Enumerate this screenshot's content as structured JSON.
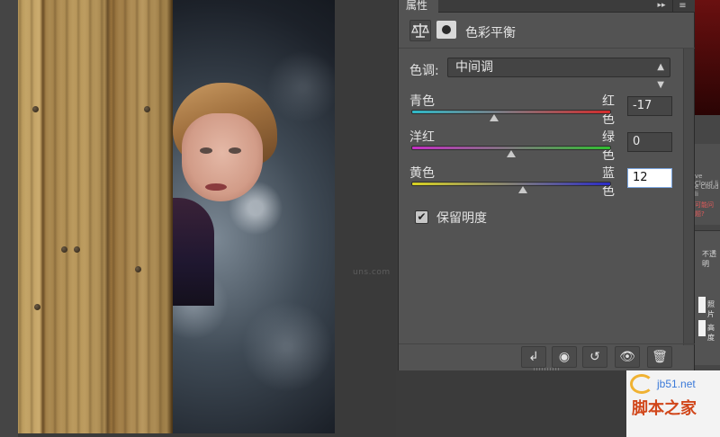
{
  "panel": {
    "tab_label": "属性",
    "collapse_glyph": "▸▸",
    "menu_glyph": "≡",
    "title": "色彩平衡",
    "tone_label": "色调:",
    "tone_value": "中间调",
    "sliders": [
      {
        "left": "青色",
        "right": "红色",
        "value": "-17",
        "position": 0.415
      },
      {
        "left": "洋红",
        "right": "绿色",
        "value": "0",
        "position": 0.5
      },
      {
        "left": "黄色",
        "right": "蓝色",
        "value": "12",
        "position": 0.56
      }
    ],
    "preserve_label": "保留明度",
    "preserve_checked": true,
    "footer_icons": [
      "clip-to-layer-icon",
      "view-previous-icon",
      "reset-icon",
      "visibility-icon",
      "delete-icon"
    ],
    "footer_glyphs": [
      "↲",
      "◉",
      "↺",
      "👁",
      "🗑"
    ]
  },
  "canvas": {
    "watermark": "uns.com"
  },
  "right_dock": {
    "cc_line1": "ve Cloud li",
    "cc_line2": "e Cloud li",
    "cc_line3": "可能问题?",
    "opacity_label": "不透明",
    "layer1_name": "照片",
    "layer2_name": "高度"
  },
  "site_logo": {
    "url": "jb51.net",
    "name": "脚本之家"
  },
  "colors": {
    "panel_bg": "#535353",
    "accent_input": "#7aa5e0",
    "track_cyan_red": [
      "#2fb9c8",
      "#d42b2b"
    ],
    "track_magenta_green": [
      "#c42ec4",
      "#30c030"
    ],
    "track_yellow_blue": [
      "#d8d222",
      "#2a2ac8"
    ]
  }
}
